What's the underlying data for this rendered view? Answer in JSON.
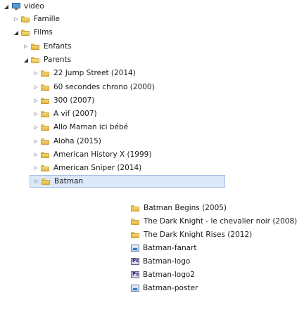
{
  "tree": [
    {
      "label": "video",
      "indent": 0,
      "type": "root",
      "open": true
    },
    {
      "label": "Famille",
      "indent": 1,
      "type": "folder",
      "open": false
    },
    {
      "label": "Films",
      "indent": 1,
      "type": "folder",
      "open": true
    },
    {
      "label": "Enfants",
      "indent": 2,
      "type": "folder",
      "open": false
    },
    {
      "label": "Parents",
      "indent": 2,
      "type": "folder",
      "open": true
    },
    {
      "label": "22 Jump Street (2014)",
      "indent": 3,
      "type": "folder",
      "open": false
    },
    {
      "label": "60 secondes chrono (2000)",
      "indent": 3,
      "type": "folder",
      "open": false
    },
    {
      "label": "300 (2007)",
      "indent": 3,
      "type": "folder",
      "open": false
    },
    {
      "label": "A vif (2007)",
      "indent": 3,
      "type": "folder",
      "open": false
    },
    {
      "label": "Allo Maman ici bébé",
      "indent": 3,
      "type": "folder",
      "open": false
    },
    {
      "label": "Aloha (2015)",
      "indent": 3,
      "type": "folder",
      "open": false
    },
    {
      "label": "American History X (1999)",
      "indent": 3,
      "type": "folder",
      "open": false
    },
    {
      "label": "American Sniper (2014)",
      "indent": 3,
      "type": "folder",
      "open": false
    },
    {
      "label": "Batman",
      "indent": 3,
      "type": "folder",
      "open": false,
      "selected": true
    }
  ],
  "popup": [
    {
      "label": "Batman Begins (2005)",
      "type": "folder"
    },
    {
      "label": "The Dark Knight - le chevalier noir (2008)",
      "type": "folder"
    },
    {
      "label": "The Dark Knight Rises (2012)",
      "type": "folder"
    },
    {
      "label": "Batman-fanart",
      "type": "image"
    },
    {
      "label": "Batman-logo",
      "type": "psd"
    },
    {
      "label": "Batman-logo2",
      "type": "psd"
    },
    {
      "label": "Batman-poster",
      "type": "image"
    }
  ]
}
